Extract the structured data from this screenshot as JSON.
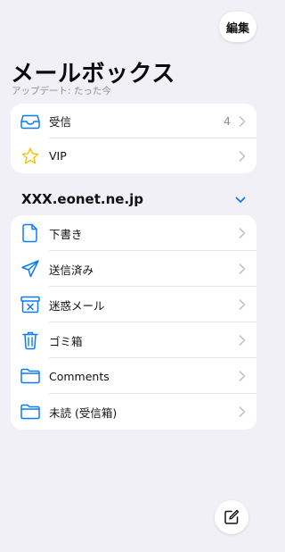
{
  "header": {
    "edit_label": "編集",
    "title": "メールボックス",
    "subtitle": "アップデート: たった今"
  },
  "favorites": [
    {
      "label": "受信",
      "count": "4",
      "icon": "inbox-tray-icon"
    },
    {
      "label": "VIP",
      "count": "",
      "icon": "star-icon"
    }
  ],
  "account": {
    "name": "XXX.eonet.ne.jp",
    "folders": [
      {
        "label": "下書き",
        "icon": "document-icon"
      },
      {
        "label": "送信済み",
        "icon": "paper-plane-icon"
      },
      {
        "label": "迷惑メール",
        "icon": "junk-box-icon"
      },
      {
        "label": "ゴミ箱",
        "icon": "trash-icon"
      },
      {
        "label": "Comments",
        "icon": "folder-icon"
      },
      {
        "label": "未読 (受信箱)",
        "icon": "folder-icon"
      }
    ]
  },
  "colors": {
    "accent": "#0a7aff",
    "star": "#f5c000",
    "background": "#f1f0f6",
    "chevron": "#c4c4c9"
  }
}
